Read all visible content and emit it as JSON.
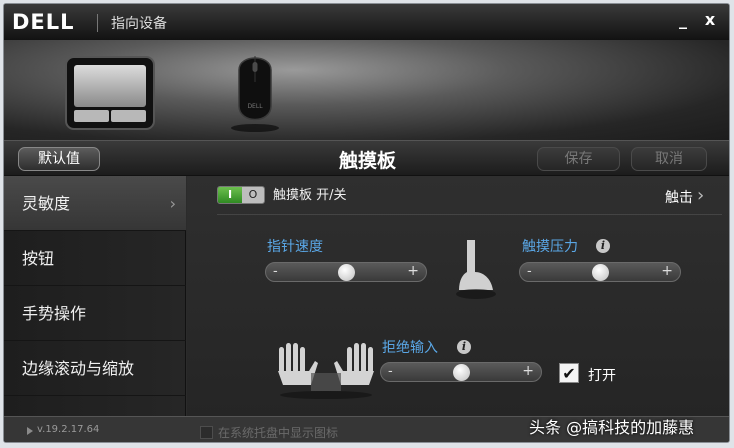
{
  "window": {
    "logo": "DELL",
    "title": "指向设备",
    "minimize_glyph": "_",
    "close_glyph": "x"
  },
  "toolbar": {
    "default_label": "默认值",
    "page_title": "触摸板",
    "save_label": "保存",
    "cancel_label": "取消"
  },
  "sidebar": {
    "items": [
      {
        "label": "灵敏度",
        "active": true,
        "chevron": "›"
      },
      {
        "label": "按钮"
      },
      {
        "label": "手势操作"
      },
      {
        "label": "边缘滚动与缩放"
      }
    ]
  },
  "main": {
    "toggle": {
      "on_text": "I",
      "off_text": "O",
      "state": "on"
    },
    "toggle_label": "触摸板 开/关",
    "tap_link": "触击",
    "tap_chevron": "›",
    "pointer_speed": {
      "label": "指针速度",
      "value": 0.5
    },
    "touch_pressure": {
      "label": "触摸压力",
      "value": 0.5,
      "info": "i"
    },
    "palm_rejection": {
      "label": "拒绝输入",
      "value": 0.5,
      "info": "i"
    },
    "slider_minus": "-",
    "slider_plus": "+",
    "palm_checkbox": {
      "checked": true,
      "glyph": "✔",
      "label": "打开"
    }
  },
  "footer": {
    "version": "v.19.2.17.64",
    "tray_label": "在系统托盘中显示图标"
  },
  "watermark": "头条 @搞科技的加藤惠",
  "colors": {
    "accent_label": "#5aa7e6",
    "toggle_on": "#4caf50"
  }
}
